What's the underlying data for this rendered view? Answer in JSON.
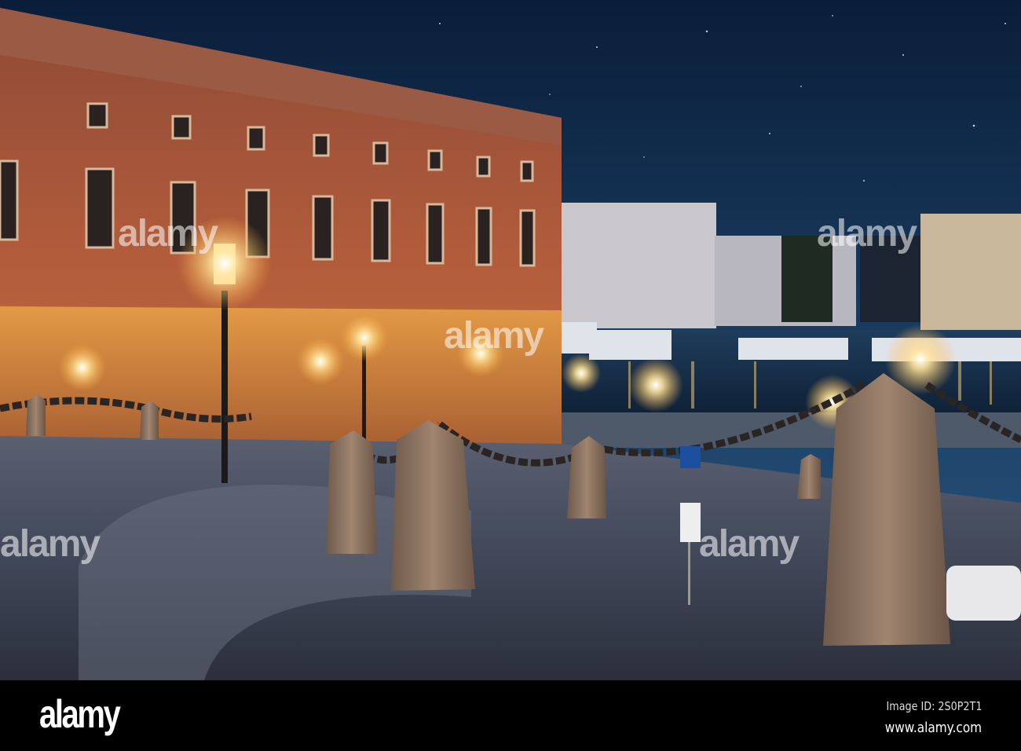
{
  "footer": {
    "logo": "alamy",
    "image_id": "Image ID: 2S0P2T1",
    "url": "www.alamy.com"
  },
  "watermark": {
    "text": "alamy"
  },
  "colors": {
    "sky_top": "#0a1e3a",
    "sky_bottom": "#2a5a86",
    "facade": "#b25a3c",
    "base_lit": "#d8893c",
    "cobble": "#3b4454",
    "footer": "#000000"
  }
}
